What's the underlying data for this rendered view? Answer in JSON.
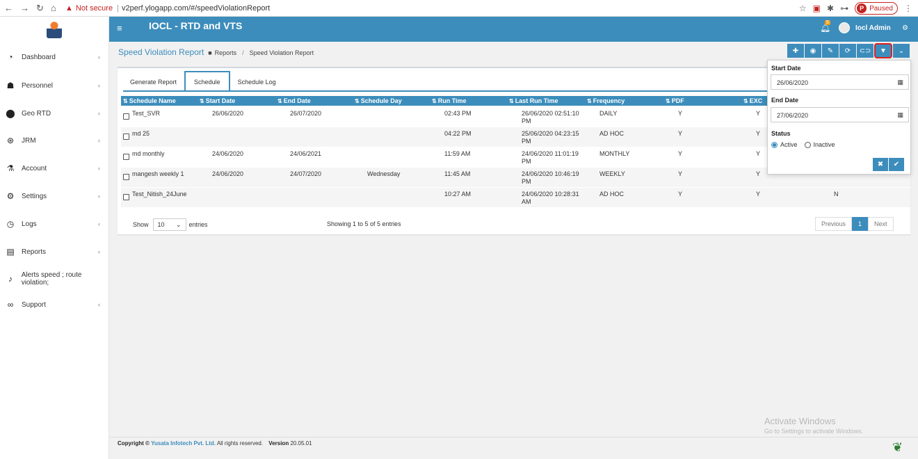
{
  "browser": {
    "url": "v2perf.ylogapp.com/#/speedViolationReport",
    "warning": "Not secure",
    "paused": "Paused",
    "profile_initial": "P"
  },
  "header": {
    "title": "IOCL - RTD and VTS",
    "user": "Iocl Admin",
    "notif_count": "5"
  },
  "sidebar": {
    "items": [
      {
        "label": "Dashboard",
        "icon": "dashboard-icon"
      },
      {
        "label": "Personnel",
        "icon": "personnel-icon"
      },
      {
        "label": "Geo RTD",
        "icon": "map-marker-icon"
      },
      {
        "label": "JRM",
        "icon": "life-ring-icon"
      },
      {
        "label": "Account",
        "icon": "flask-icon"
      },
      {
        "label": "Settings",
        "icon": "gear-icon"
      },
      {
        "label": "Logs",
        "icon": "clock-icon"
      },
      {
        "label": "Reports",
        "icon": "report-icon"
      },
      {
        "label": "Alerts speed ; route violation;",
        "icon": "bell-icon"
      },
      {
        "label": "Support",
        "icon": "support-icon"
      }
    ]
  },
  "breadcrumb": {
    "page_title": "Speed Violation Report",
    "reports": "Reports",
    "current": "Speed Violation Report"
  },
  "tabs": [
    "Generate Report",
    "Schedule",
    "Schedule Log"
  ],
  "table": {
    "columns": [
      "Schedule Name",
      "Start Date",
      "End Date",
      "Schedule Day",
      "Run Time",
      "Last Run Time",
      "Frequency",
      "PDF",
      "EXC"
    ],
    "rows": [
      {
        "name": "Test_SVR",
        "start": "26/06/2020",
        "end": "26/07/2020",
        "day": "",
        "run": "02:43 PM",
        "last1": "26/06/2020 02:51:10",
        "last2": "PM",
        "freq": "DAILY",
        "pdf": "Y",
        "exc": "Y",
        "extra": ""
      },
      {
        "name": "md 25",
        "start": "",
        "end": "",
        "day": "",
        "run": "04:22 PM",
        "last1": "25/06/2020 04:23:15",
        "last2": "PM",
        "freq": "AD HOC",
        "pdf": "Y",
        "exc": "Y",
        "extra": ""
      },
      {
        "name": "md monthly",
        "start": "24/06/2020",
        "end": "24/06/2021",
        "day": "",
        "run": "11:59 AM",
        "last1": "24/06/2020 11:01:19",
        "last2": "PM",
        "freq": "MONTHLY",
        "pdf": "Y",
        "exc": "Y",
        "extra": ""
      },
      {
        "name": "mangesh weekly 1",
        "start": "24/06/2020",
        "end": "24/07/2020",
        "day": "Wednesday",
        "run": "11:45 AM",
        "last1": "24/06/2020 10:46:19",
        "last2": "PM",
        "freq": "WEEKLY",
        "pdf": "Y",
        "exc": "Y",
        "extra": ""
      },
      {
        "name": "Test_Nitish_24June",
        "start": "",
        "end": "",
        "day": "",
        "run": "10:27 AM",
        "last1": "24/06/2020 10:28:31",
        "last2": "AM",
        "freq": "AD HOC",
        "pdf": "Y",
        "exc": "Y",
        "extra": "N"
      }
    ],
    "show": "Show",
    "entries": "entries",
    "page_size": "10",
    "showing": "Showing 1 to 5 of 5 entries",
    "prev": "Previous",
    "page": "1",
    "next": "Next"
  },
  "filter": {
    "start_label": "Start Date",
    "start_value": "26/06/2020",
    "end_label": "End Date",
    "end_value": "27/06/2020",
    "status_label": "Status",
    "active": "Active",
    "inactive": "Inactive",
    "status_selected": "Active"
  },
  "footer": {
    "copyright": "Copyright ©",
    "company": "Yusata Infotech Pvt. Ltd.",
    "rights": "All rights reserved.",
    "version_label": "Version",
    "version": "20.05.01"
  },
  "watermark": {
    "line1": "Activate Windows",
    "line2": "Go to Settings to activate Windows."
  }
}
